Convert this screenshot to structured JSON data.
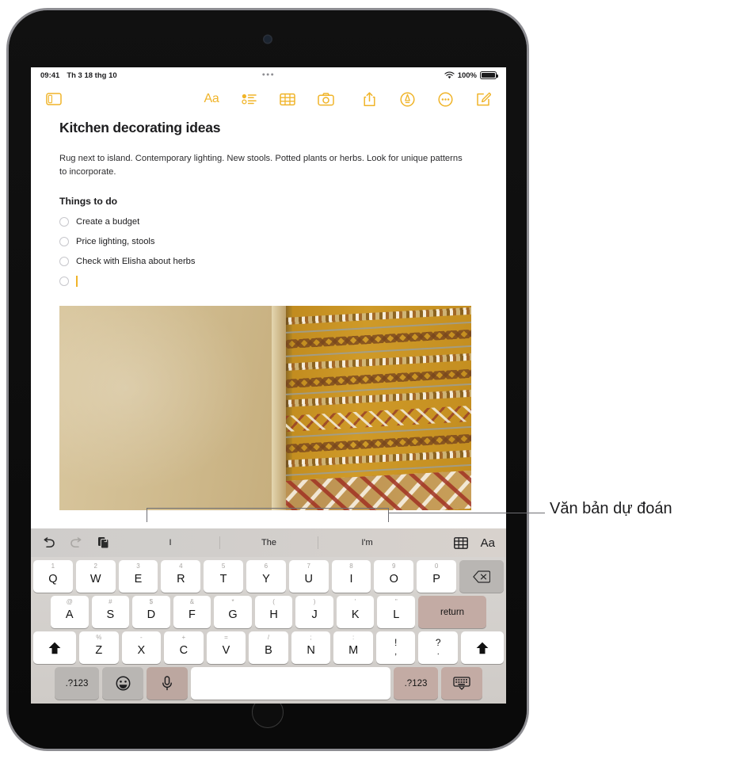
{
  "status_bar": {
    "time": "09:41",
    "date": "Th 3 18 thg 10",
    "dots": "•••",
    "battery_percent": "100%",
    "wifi_icon": "wifi-icon",
    "battery_icon": "battery-full-icon"
  },
  "toolbar": {
    "sidebar_icon": "sidebar-toggle-icon",
    "format_label": "Aa",
    "checklist_icon": "checklist-icon",
    "table_icon": "table-icon",
    "camera_icon": "camera-icon",
    "share_icon": "share-icon",
    "markup_icon": "markup-pen-icon",
    "more_icon": "more-ellipsis-icon",
    "compose_icon": "compose-new-note-icon",
    "accent_color": "#f0b429"
  },
  "note": {
    "title": "Kitchen decorating ideas",
    "paragraph": "Rug next to island. Contemporary lighting. New stools. Potted plants or herbs. Look for unique patterns to incorporate.",
    "subheading": "Things to do",
    "todos": [
      {
        "label": "Create a budget",
        "checked": false
      },
      {
        "label": "Price lighting, stools",
        "checked": false
      },
      {
        "label": "Check with Elisha about herbs",
        "checked": false
      },
      {
        "label": "",
        "checked": false,
        "active": true
      }
    ],
    "photo_alt": "woven-rug-photo"
  },
  "shortcut_bar": {
    "undo_icon": "undo-icon",
    "redo_icon": "redo-icon",
    "paste_icon": "paste-icon",
    "table_icon": "table-icon",
    "format_label": "Aa",
    "predictions": [
      "I",
      "The",
      "I'm"
    ]
  },
  "keyboard": {
    "row1": [
      {
        "alt": "1",
        "main": "Q"
      },
      {
        "alt": "2",
        "main": "W"
      },
      {
        "alt": "3",
        "main": "E"
      },
      {
        "alt": "4",
        "main": "R"
      },
      {
        "alt": "5",
        "main": "T"
      },
      {
        "alt": "6",
        "main": "Y"
      },
      {
        "alt": "7",
        "main": "U"
      },
      {
        "alt": "8",
        "main": "I"
      },
      {
        "alt": "9",
        "main": "O"
      },
      {
        "alt": "0",
        "main": "P"
      }
    ],
    "delete_icon": "delete-backspace-icon",
    "row2": [
      {
        "alt": "@",
        "main": "A"
      },
      {
        "alt": "#",
        "main": "S"
      },
      {
        "alt": "$",
        "main": "D"
      },
      {
        "alt": "&",
        "main": "F"
      },
      {
        "alt": "*",
        "main": "G"
      },
      {
        "alt": "(",
        "main": "H"
      },
      {
        "alt": ")",
        "main": "J"
      },
      {
        "alt": "'",
        "main": "K"
      },
      {
        "alt": "\"",
        "main": "L"
      }
    ],
    "return_label": "return",
    "row3": [
      {
        "alt": "%",
        "main": "Z"
      },
      {
        "alt": "-",
        "main": "X"
      },
      {
        "alt": "+",
        "main": "C"
      },
      {
        "alt": "=",
        "main": "V"
      },
      {
        "alt": "/",
        "main": "B"
      },
      {
        "alt": ";",
        "main": "N"
      },
      {
        "alt": ":",
        "main": "M"
      }
    ],
    "punct1": {
      "main": "!",
      "sub": ","
    },
    "punct2": {
      "main": "?",
      "sub": "."
    },
    "shift_icon": "shift-icon",
    "row4": {
      "numbers_left": ".?123",
      "emoji_icon": "emoji-smiley-icon",
      "dictation_icon": "microphone-icon",
      "space_label": "",
      "numbers_right": ".?123",
      "dismiss_icon": "hide-keyboard-icon"
    }
  },
  "callout": {
    "label": "Văn bản dự đoán"
  },
  "device": {
    "camera_icon": "front-camera-icon",
    "home_button_icon": "home-button-icon"
  }
}
